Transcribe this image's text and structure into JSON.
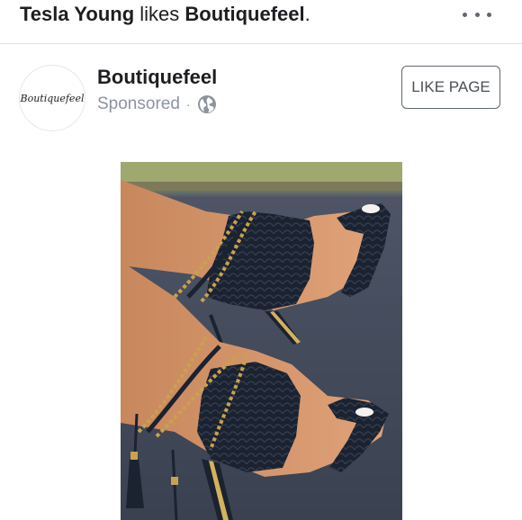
{
  "story": {
    "actor": "Tesla Young",
    "verb": " likes ",
    "target": "Boutiquefeel",
    "punct": "."
  },
  "post": {
    "page_name": "Boutiquefeel",
    "sponsored_label": "Sponsored",
    "separator": "·",
    "audience_icon": "globe-icon",
    "like_button_label": "LIKE PAGE",
    "avatar_logo_text": "Boutiquefeel"
  },
  "ad": {
    "image_subject": "black woven high-heel sandals with gold chain ankle straps"
  },
  "colors": {
    "text_primary": "#1c1e21",
    "text_secondary": "#8d949e",
    "divider": "#dfe1e5",
    "icon_gray": "#606770"
  }
}
